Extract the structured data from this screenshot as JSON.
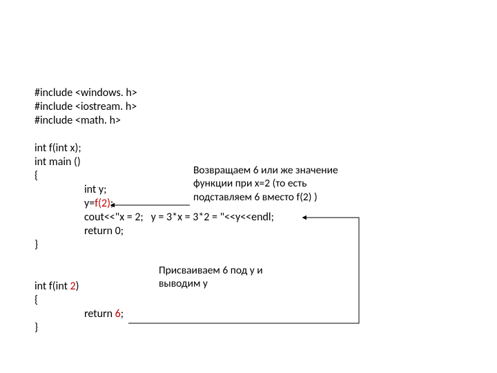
{
  "code": {
    "inc1": "#include <windows. h>",
    "inc2": "#include <iostream. h>",
    "inc3": "#include <math. h>",
    "blank1": "",
    "fdecl": "int f(int x);",
    "main_sig": "int main ()",
    "main_open": "{",
    "inty": "int y;",
    "yassign_pre": "y=",
    "yassign_call_f": "f(",
    "yassign_call_arg": "2",
    "yassign_call_close": ")",
    "yassign_semi": ";",
    "cout": "cout<<\"x = 2;   y = 3*x = 3*2 = \"<<y<<endl;",
    "ret0": "return 0;",
    "main_close": "}",
    "fdef_pre": "int f(int ",
    "fdef_arg": "2",
    "fdef_close": ")",
    "fdef_open": "{",
    "fret_pre": "return ",
    "fret_val": "6",
    "fret_semi": ";",
    "fdef_close2": "}"
  },
  "annot": {
    "top1": "Возвращаем 6 или же значение",
    "top2": "функции при x=2 (то есть",
    "top3": "подставляем 6 вместо f(2) )",
    "mid1": "Присваиваем 6 под y и",
    "mid2": "выводим y"
  }
}
